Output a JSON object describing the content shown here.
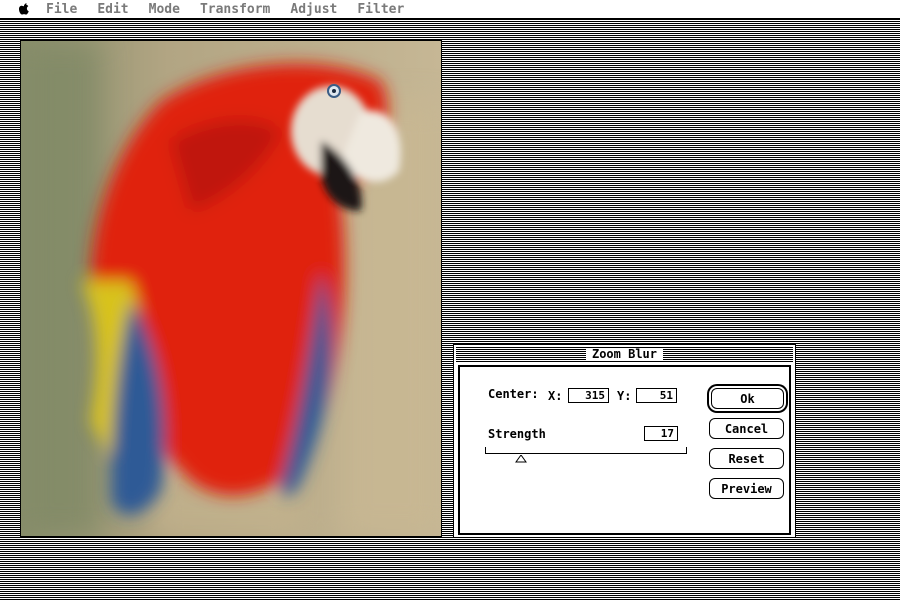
{
  "menubar": {
    "apple_icon": "apple-icon",
    "items": [
      "File",
      "Edit",
      "Mode",
      "Transform",
      "Adjust",
      "Filter"
    ]
  },
  "document": {
    "image_description": "zoom-blurred scarlet macaw photograph",
    "colors": {
      "red": "#e0220e",
      "blue": "#2d5a96",
      "yellow": "#d8c21e",
      "background": "#b9ae8d"
    }
  },
  "dialog": {
    "title": "Zoom Blur",
    "center_label": "Center:",
    "x_label": "X:",
    "x_value": "315",
    "y_label": "Y:",
    "y_value": "51",
    "strength_label": "Strength",
    "strength_value": "17",
    "strength_slider_fraction": 0.17,
    "buttons": {
      "ok": "Ok",
      "cancel": "Cancel",
      "reset": "Reset",
      "preview": "Preview"
    }
  }
}
